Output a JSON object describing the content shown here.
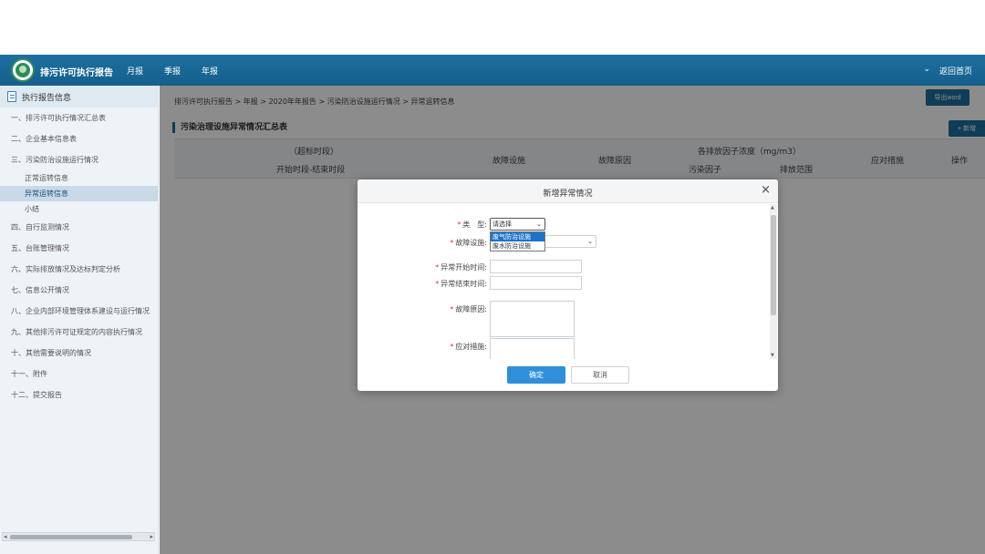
{
  "header": {
    "app_title": "排污许可执行报告",
    "nav": [
      "月报",
      "季报",
      "年报"
    ],
    "user_chevron": "⌄",
    "back_home": "返回首页"
  },
  "sidebar": {
    "title": "执行报告信息",
    "items": [
      "一、排污许可执行情况汇总表",
      "二、企业基本信息表",
      "三、污染防治设施运行情况",
      "正常运转信息",
      "异常运转信息",
      "小结",
      "四、自行监测情况",
      "五、台账管理情况",
      "六、实际排放情况及达标判定分析",
      "七、信息公开情况",
      "八、企业内部环境管理体系建设与运行情况",
      "九、其他排污许可证规定的内容执行情况",
      "十、其他需要说明的情况",
      "十一、附件",
      "十二、提交报告"
    ],
    "active_index": 4
  },
  "main": {
    "breadcrumb": "排污许可执行报告 > 年报 > 2020年年报告 > 污染防治设施运行情况 > 异常运转信息",
    "export_button": "导出word",
    "section_title": "污染治理设施异常情况汇总表",
    "add_button": "+ 新增",
    "table_headers": {
      "period_group": "（超标时段）",
      "period": "开始时段-结束时段",
      "fault_facility": "故障设施",
      "fault_reason": "故障原因",
      "concentration_group": "各排放因子浓度（mg/m3）",
      "pollutant": "污染因子",
      "emission_range": "排放范围",
      "measures": "应对措施",
      "operation": "操作"
    }
  },
  "modal": {
    "title": "新增异常情况",
    "close": "×",
    "fields": {
      "type_label": "类　型:",
      "type_value": "请选择",
      "type_options": [
        "废气防治设施",
        "废水防治设施"
      ],
      "facility_label": "故障设施:",
      "start_label": "异常开始时间:",
      "end_label": "异常结束时间:",
      "reason_label": "故障原因:",
      "measure_label": "应对措施:"
    },
    "required_mark": "*",
    "ok_button": "确定",
    "cancel_button": "取消"
  }
}
